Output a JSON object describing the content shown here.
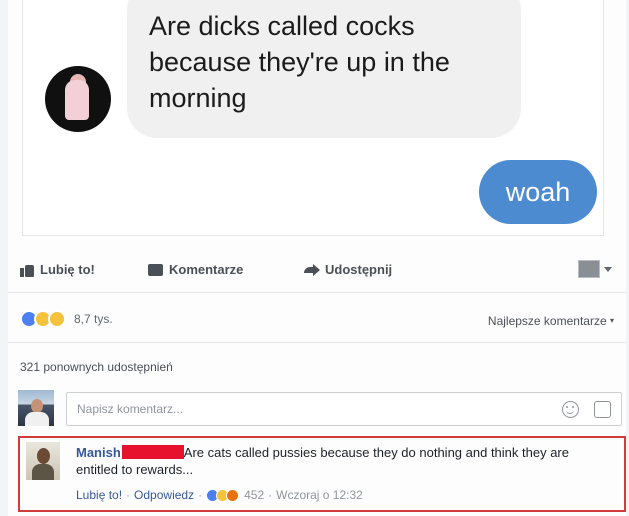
{
  "chat": {
    "incoming_message": "Are dicks called cocks because they're up in the morning",
    "outgoing_message": "woah"
  },
  "actions": {
    "like_label": "Lubię to!",
    "comment_label": "Komentarze",
    "share_label": "Udostępnij"
  },
  "reactions": {
    "count": "8,7 tys.",
    "sort_label": "Najlepsze komentarze"
  },
  "shares": {
    "text": "321 ponownych udostępnień"
  },
  "comment_input": {
    "placeholder": "Napisz komentarz..."
  },
  "comment": {
    "author": "Manish",
    "text": "Are cats called pussies because they do nothing and think they are entitled to rewards...",
    "like_link": "Lubię to!",
    "reply_link": "Odpowiedz",
    "reaction_count": "452",
    "timestamp": "Wczoraj o 12:32"
  },
  "colors": {
    "outgoing_bubble": "#4d8bd1",
    "incoming_bubble": "#f1f0f0",
    "link": "#365899",
    "highlight_border": "#d33a3a",
    "redaction": "#e8112d"
  }
}
